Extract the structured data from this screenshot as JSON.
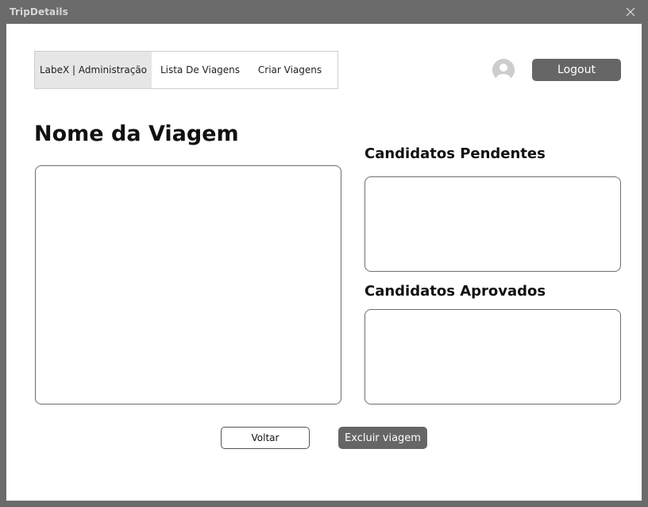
{
  "window": {
    "title": "TripDetails",
    "close_icon": "close-icon"
  },
  "nav": {
    "items": [
      {
        "label": "LabeX | Administração",
        "active": true
      },
      {
        "label": "Lista De Viagens",
        "active": false
      },
      {
        "label": "Criar Viagens",
        "active": false
      }
    ]
  },
  "header": {
    "avatar_icon": "user-avatar-icon",
    "logout_label": "Logout"
  },
  "main": {
    "trip_name": "Nome da Viagem",
    "pending_title": "Candidatos Pendentes",
    "approved_title": "Candidatos Aprovados"
  },
  "actions": {
    "back_label": "Voltar",
    "delete_label": "Excluir viagem"
  },
  "colors": {
    "frame": "#6b6b6b",
    "button_dark": "#666666",
    "nav_active": "#e6e6e6"
  }
}
